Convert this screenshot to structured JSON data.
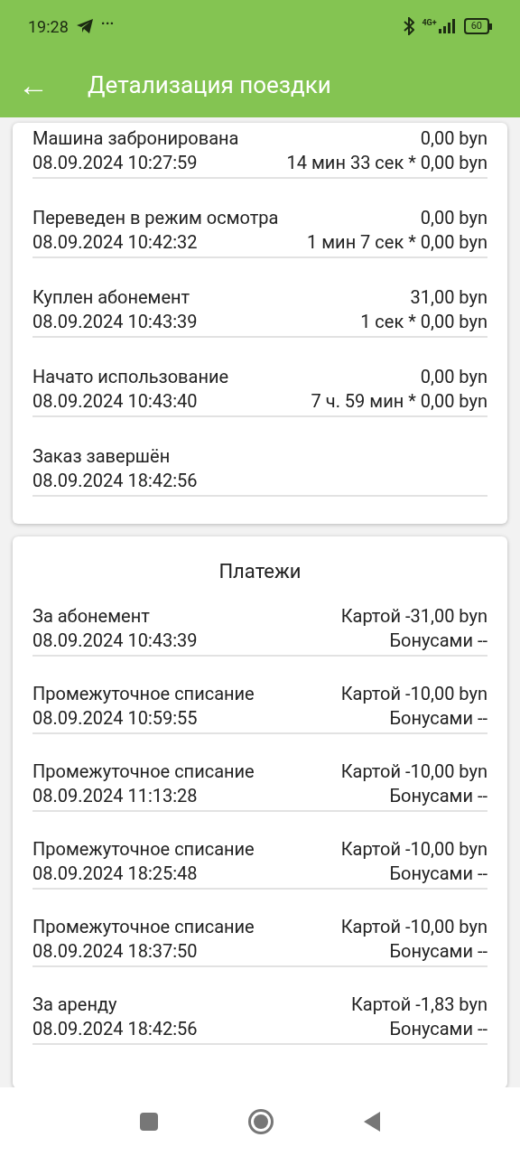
{
  "status_bar": {
    "time": "19:28",
    "more": "···",
    "network": "4G+",
    "battery": "60"
  },
  "app_bar": {
    "back": "←",
    "title": "Детализация поездки"
  },
  "events": [
    {
      "title": "Машина забронирована",
      "date": "08.09.2024 10:27:59",
      "amount": "0,00 byn",
      "rate": "14 мин 33 сек * 0,00 byn"
    },
    {
      "title": "Переведен в режим осмотра",
      "date": "08.09.2024 10:42:32",
      "amount": "0,00 byn",
      "rate": "1 мин 7 сек * 0,00 byn"
    },
    {
      "title": "Куплен абонемент",
      "date": "08.09.2024 10:43:39",
      "amount": "31,00 byn",
      "rate": "1 сек * 0,00 byn"
    },
    {
      "title": "Начато использование",
      "date": "08.09.2024 10:43:40",
      "amount": "0,00 byn",
      "rate": "7 ч. 59 мин * 0,00 byn"
    },
    {
      "title": "Заказ завершён",
      "date": "08.09.2024 18:42:56"
    }
  ],
  "payments": {
    "title": "Платежи",
    "items": [
      {
        "title": "За абонемент",
        "date": "08.09.2024 10:43:39",
        "card": "Картой -31,00 byn",
        "bonus": "Бонусами --"
      },
      {
        "title": "Промежуточное списание",
        "date": "08.09.2024 10:59:55",
        "card": "Картой -10,00 byn",
        "bonus": "Бонусами --"
      },
      {
        "title": "Промежуточное списание",
        "date": "08.09.2024 11:13:28",
        "card": "Картой -10,00 byn",
        "bonus": "Бонусами --"
      },
      {
        "title": "Промежуточное списание",
        "date": "08.09.2024 18:25:48",
        "card": "Картой -10,00 byn",
        "bonus": "Бонусами --"
      },
      {
        "title": "Промежуточное списание",
        "date": "08.09.2024 18:37:50",
        "card": "Картой -10,00 byn",
        "bonus": "Бонусами --"
      },
      {
        "title": "За аренду",
        "date": "08.09.2024 18:42:56",
        "card": "Картой -1,83 byn",
        "bonus": "Бонусами --"
      }
    ]
  }
}
